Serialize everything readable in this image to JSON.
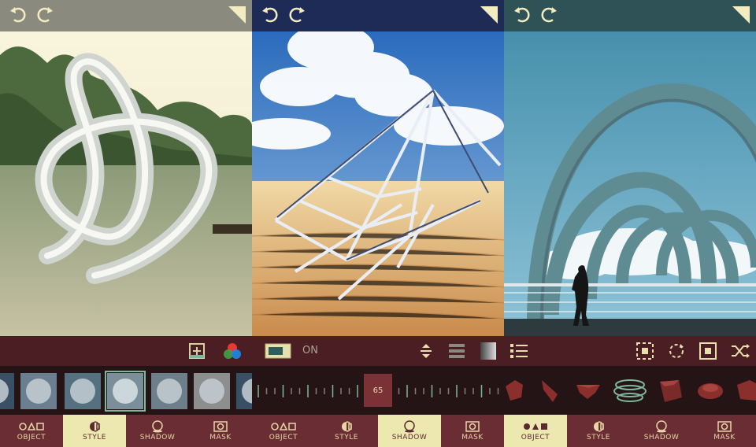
{
  "panels": [
    {
      "id": "object-style",
      "topbar_color": "#8a8a7e",
      "strip_colors": [
        "#394f63",
        "#6a8090",
        "#55707e",
        "#7b8f9b",
        "#6e7f8c",
        "#8b8f8e"
      ],
      "ctrl": {
        "icons": [
          "add-image-icon",
          "rgb-color-icon"
        ]
      },
      "tabs": [
        {
          "label": "OBJECT",
          "icon": "object-shapes-icon",
          "active": false
        },
        {
          "label": "STYLE",
          "icon": "style-half-icon",
          "active": true
        },
        {
          "label": "SHADOW",
          "icon": "shadow-circle-icon",
          "active": false
        },
        {
          "label": "MASK",
          "icon": "mask-square-icon",
          "active": false
        }
      ]
    },
    {
      "id": "shadow",
      "topbar_color": "#1e2b57",
      "ctrl": {
        "toggle_label": "ON",
        "icons": [
          "toggle-box-icon",
          "vertical-align-icon",
          "stripes-icon",
          "gradient-icon"
        ]
      },
      "slider": {
        "value": "65"
      },
      "tabs": [
        {
          "label": "OBJECT",
          "icon": "object-shapes-icon",
          "active": false
        },
        {
          "label": "STYLE",
          "icon": "style-half-icon",
          "active": false
        },
        {
          "label": "SHADOW",
          "icon": "shadow-circle-icon",
          "active": true
        },
        {
          "label": "MASK",
          "icon": "mask-square-icon",
          "active": false
        }
      ]
    },
    {
      "id": "object",
      "topbar_color": "#2f5257",
      "ctrl": {
        "icons": [
          "list-icon",
          "crosshair-icon",
          "rotate-icon",
          "center-square-icon",
          "shuffle-icon"
        ]
      },
      "tabs": [
        {
          "label": "OBJECT",
          "icon": "object-filled-icon",
          "active": true
        },
        {
          "label": "STYLE",
          "icon": "style-half-icon",
          "active": false
        },
        {
          "label": "SHADOW",
          "icon": "shadow-circle-icon",
          "active": false
        },
        {
          "label": "MASK",
          "icon": "mask-square-icon",
          "active": false
        }
      ]
    }
  ]
}
